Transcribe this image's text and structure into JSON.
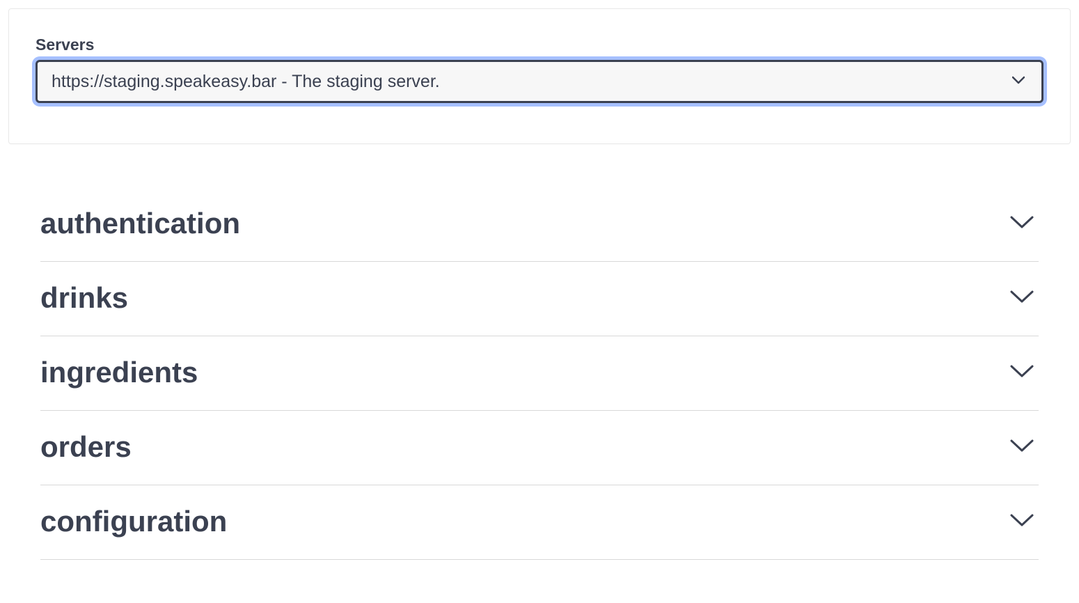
{
  "servers": {
    "label": "Servers",
    "selected": "https://staging.speakeasy.bar - The staging server."
  },
  "sections": [
    {
      "title": "authentication"
    },
    {
      "title": "drinks"
    },
    {
      "title": "ingredients"
    },
    {
      "title": "orders"
    },
    {
      "title": "configuration"
    }
  ]
}
